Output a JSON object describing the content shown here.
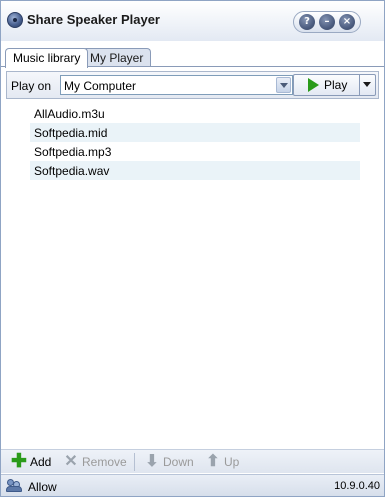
{
  "window": {
    "title": "Share Speaker Player"
  },
  "title_buttons": {
    "help": "?",
    "minimize": "–",
    "close": "×"
  },
  "tabs": [
    {
      "label": "Music library",
      "active": true
    },
    {
      "label": "My Player",
      "active": false
    }
  ],
  "play_row": {
    "label": "Play on",
    "device": "My Computer",
    "play_label": "Play"
  },
  "files": [
    "AllAudio.m3u",
    "Softpedia.mid",
    "Softpedia.mp3",
    "Softpedia.wav"
  ],
  "toolbar": {
    "add": "Add",
    "remove": "Remove",
    "down": "Down",
    "up": "Up"
  },
  "status": {
    "text": "Allow",
    "version": "10.9.0.40"
  },
  "colors": {
    "play_green": "#2a9b1a",
    "row_alt": "#eaf3f8",
    "disabled_text": "#9a9a9a"
  },
  "icons": {
    "app": "speaker-icon",
    "play": "play-icon",
    "add": "plus-icon",
    "remove": "x-icon",
    "down": "down-arrow-icon",
    "up": "up-arrow-icon",
    "status": "users-icon"
  }
}
